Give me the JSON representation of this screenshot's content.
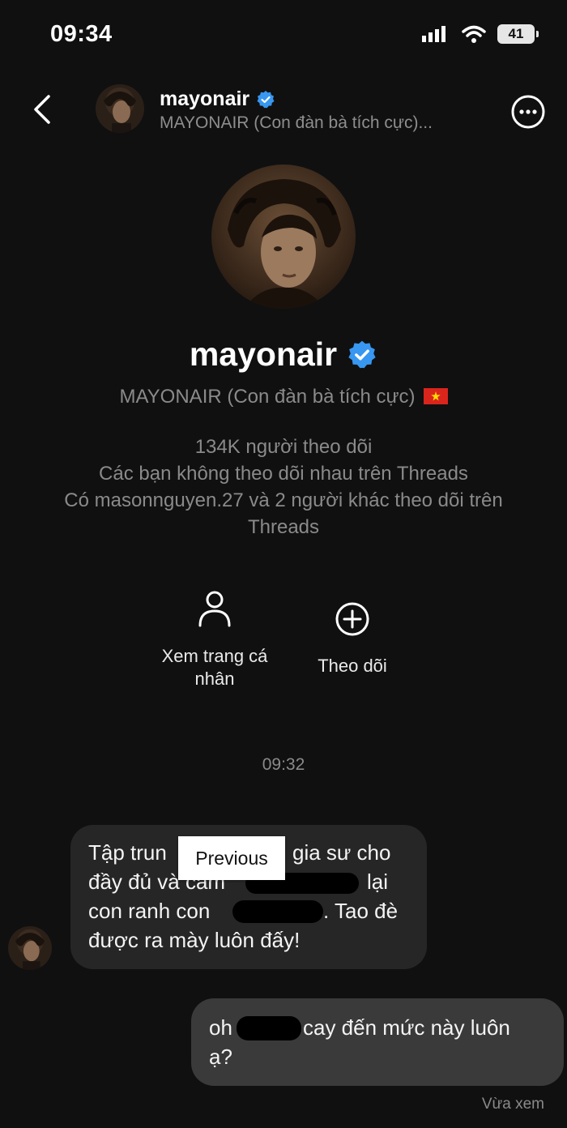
{
  "status_bar": {
    "time": "09:34",
    "battery": "41"
  },
  "header": {
    "username": "mayonair",
    "subtitle": "MAYONAIR (Con đàn bà tích cực)..."
  },
  "profile": {
    "username": "mayonair",
    "full_name": "MAYONAIR (Con đàn bà tích cực)",
    "followers": "134K người theo dõi",
    "mutual_status": "Các bạn không theo dõi nhau trên Threads",
    "followed_by": "Có masonnguyen.27 và 2 người khác theo dõi trên Threads",
    "view_profile_label": "Xem trang cá nhân",
    "follow_label": "Theo dõi"
  },
  "conversation": {
    "timestamp": "09:32",
    "incoming": {
      "line1": "Tập trun",
      "line1b": "gia sư cho",
      "line2": "đầy đủ và cầm",
      "line2b": "lại",
      "line3": "con ranh con",
      "line3b": ". Tao đè",
      "line4": "được ra mày luôn đấy!"
    },
    "tooltip": "Previous",
    "outgoing": {
      "part1": "oh",
      "part2": "cay đến mức này luôn",
      "line2": "ạ?"
    },
    "seen_label": "Vừa xem"
  },
  "colors": {
    "verified": "#3897f0",
    "background": "#101010",
    "incoming_bubble": "#262626",
    "outgoing_bubble": "#3a3a3a"
  }
}
